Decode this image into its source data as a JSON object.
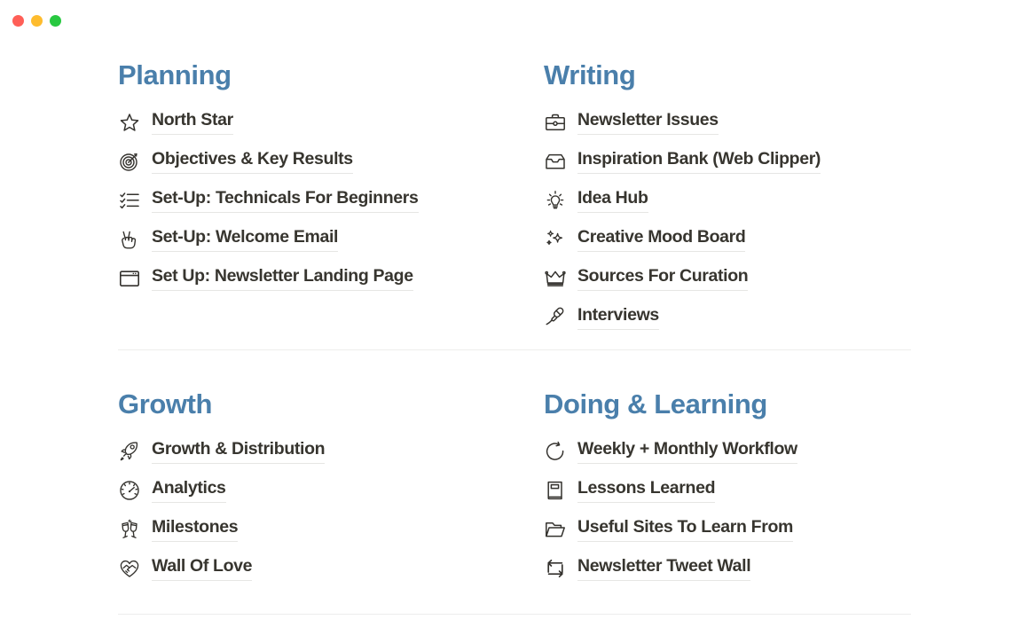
{
  "window": {
    "controls": [
      {
        "name": "close",
        "color": "#ff5f57"
      },
      {
        "name": "minimize",
        "color": "#febc2e"
      },
      {
        "name": "maximize",
        "color": "#28c840"
      }
    ]
  },
  "theme": {
    "heading_color": "#4a7fab",
    "link_color": "#37352f",
    "underline_color": "#e6e6e4",
    "divider_color": "#ededec",
    "background": "#ffffff"
  },
  "sections": [
    {
      "id": "planning",
      "title": "Planning",
      "links": [
        {
          "icon": "star-icon",
          "label": "North Star"
        },
        {
          "icon": "target-icon",
          "label": "Objectives & Key Results"
        },
        {
          "icon": "checklist-icon",
          "label": "Set-Up: Technicals For Beginners"
        },
        {
          "icon": "peace-hand-icon",
          "label": "Set-Up: Welcome Email"
        },
        {
          "icon": "browser-window-icon",
          "label": "Set Up: Newsletter Landing Page"
        }
      ]
    },
    {
      "id": "writing",
      "title": "Writing",
      "links": [
        {
          "icon": "briefcase-icon",
          "label": "Newsletter Issues"
        },
        {
          "icon": "inbox-tray-icon",
          "label": "Inspiration Bank (Web Clipper)"
        },
        {
          "icon": "lightbulb-icon",
          "label": "Idea Hub"
        },
        {
          "icon": "sparkles-icon",
          "label": "Creative Mood Board"
        },
        {
          "icon": "crown-icon",
          "label": "Sources For Curation"
        },
        {
          "icon": "microphone-icon",
          "label": "Interviews"
        }
      ]
    },
    {
      "id": "growth",
      "title": "Growth",
      "links": [
        {
          "icon": "rocket-icon",
          "label": "Growth & Distribution"
        },
        {
          "icon": "gauge-icon",
          "label": "Analytics"
        },
        {
          "icon": "cheers-glasses-icon",
          "label": "Milestones"
        },
        {
          "icon": "heart-handshake-icon",
          "label": "Wall Of Love"
        }
      ]
    },
    {
      "id": "doing-and-learning",
      "title": "Doing & Learning",
      "links": [
        {
          "icon": "refresh-circle-icon",
          "label": "Weekly + Monthly Workflow"
        },
        {
          "icon": "book-icon",
          "label": "Lessons Learned"
        },
        {
          "icon": "folder-icon",
          "label": "Useful Sites To Learn From"
        },
        {
          "icon": "retweet-icon",
          "label": "Newsletter Tweet Wall"
        }
      ]
    }
  ]
}
